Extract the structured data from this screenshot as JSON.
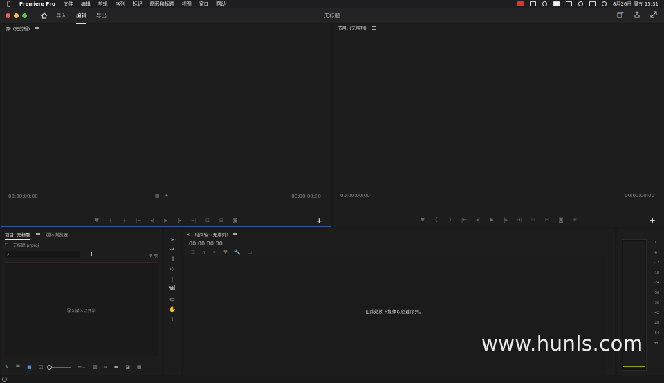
{
  "menubar": {
    "app_name": "Premiere Pro",
    "items": [
      "文件",
      "编辑",
      "剪辑",
      "序列",
      "标记",
      "图形和标题",
      "视图",
      "窗口",
      "帮助"
    ],
    "datetime": "8月26日 周五  15:31"
  },
  "appbar": {
    "modes": [
      "导入",
      "编辑",
      "导出"
    ],
    "active_mode": "编辑",
    "title": "无标题"
  },
  "source_panel": {
    "title": "源: (无剪辑)",
    "timecode_left": "00:00:00:00",
    "timecode_right": "00:00:00:00",
    "add_label": "+"
  },
  "program_panel": {
    "title": "节目: (无序列)",
    "timecode_left": "00:00:00:00",
    "timecode_right": "00:00:00:00",
    "add_label": "+"
  },
  "project_panel": {
    "tabs": [
      "项目: 无标题",
      "媒体浏览器"
    ],
    "file_name": "无标题.prproj",
    "search_placeholder": "",
    "item_count": "0 项",
    "empty_hint": "导入媒体以开始"
  },
  "timeline_panel": {
    "title": "时间轴: (无序列)",
    "timecode": "00:00:00:00",
    "empty_hint": "在此处放下媒体以创建序列。"
  },
  "audio_meter": {
    "scale": [
      "0",
      "-6",
      "-12",
      "-18",
      "-24",
      "-30",
      "-36",
      "-42",
      "-48",
      "-54",
      "dB"
    ]
  },
  "watermark": "www.hunls.com",
  "colors": {
    "accent_border": "#3a57a6",
    "background": "#1d1d1d"
  }
}
